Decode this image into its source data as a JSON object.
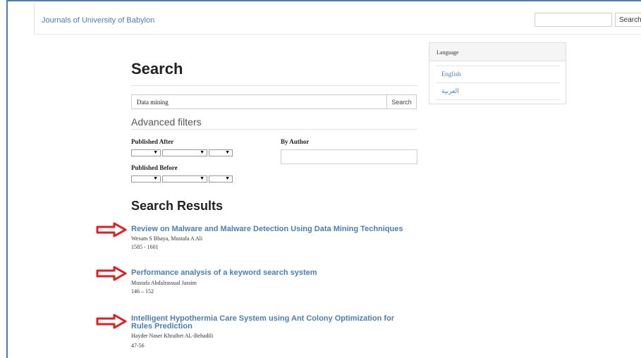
{
  "header": {
    "site_title": "Journals of University of Babylon",
    "search_placeholder": "",
    "search_button": "Search"
  },
  "search": {
    "page_title": "Search",
    "query_value": "Data mining",
    "search_button": "Search",
    "advanced_filters": "Advanced filters",
    "published_after_label": "Published After",
    "published_before_label": "Published Before",
    "by_author_label": "By Author",
    "dropdown_glyph": "▼"
  },
  "results": {
    "heading": "Search Results",
    "items": [
      {
        "title": "Review on Malware and Malware Detection Using Data Mining Techniques",
        "authors": "Wesam S Bhaya, Mustafa A Ali",
        "pages": "1585 - 1601"
      },
      {
        "title": "Performance analysis of a keyword search system",
        "authors": "Mustafa Abdalrassual Jassim",
        "pages": "146 – 152"
      },
      {
        "title_line1": "Intelligent Hypothermia Care System using Ant Colony Optimization for",
        "title_line2": "Rules Prediction",
        "authors": "Hayder Naser Khraibet AL-Behadili",
        "pages": "47-56"
      }
    ]
  },
  "language": {
    "heading": "Language",
    "options": [
      "English",
      "العربية"
    ]
  },
  "colors": {
    "link": "#4a7ebb",
    "arrow": "#e02020",
    "frame": "#4a7ebb"
  }
}
